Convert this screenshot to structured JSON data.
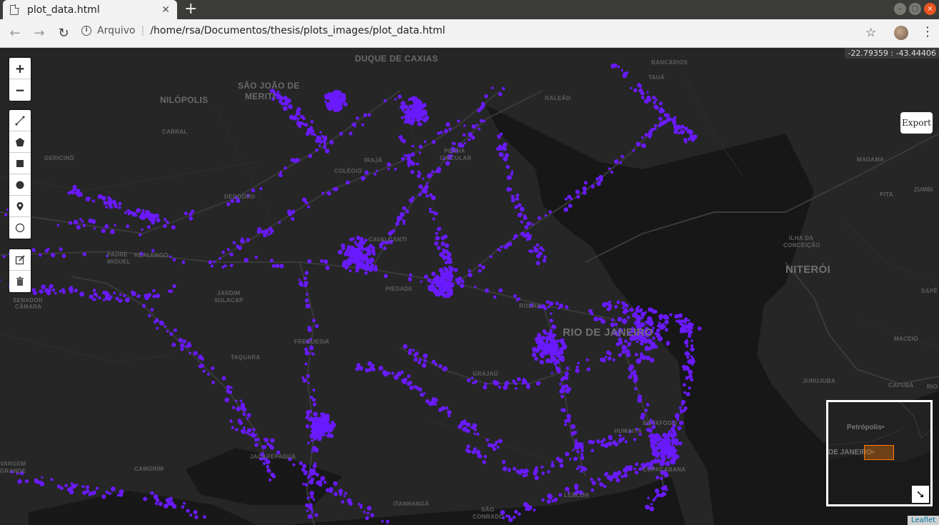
{
  "browser": {
    "tab_title": "plot_data.html",
    "tab_close": "✕",
    "new_tab": "+",
    "scheme": "Arquivo",
    "separator": "|",
    "url": "/home/rsa/Documentos/thesis/plots_images/plot_data.html",
    "icons": [
      "back-icon",
      "forward-icon",
      "reload-icon",
      "info-icon",
      "star-icon",
      "profile-icon",
      "menu-icon"
    ]
  },
  "map": {
    "coordinates": "-22.79359 : -43.44406",
    "export_label": "Export",
    "attribution": "Leaflet",
    "point_color": "#6a1aff",
    "zoom_in": "+",
    "zoom_out": "−",
    "draw_tools": [
      "polyline-icon",
      "polygon-icon",
      "rectangle-icon",
      "circle-icon",
      "marker-icon",
      "circlemarker-icon"
    ],
    "edit_tools": [
      "edit-icon",
      "delete-icon"
    ],
    "places": {
      "duque_de_caxias": "DUQUE DE CAXIAS",
      "sao_joao_1": "SÃO JOÃO DE",
      "sao_joao_2": "MERITI",
      "nilopolis": "NILÓPOLIS",
      "niteroi": "NITERÓI",
      "rio": "RIO DE JANEIRO",
      "cabral": "CABRAL",
      "gericino": "GERICINÓ",
      "bangu": "BANGU",
      "padre_miguel_1": "PADRE",
      "padre_miguel_2": "MIGUEL",
      "realengo": "REALENGO",
      "senador_camara_1": "SENADOR",
      "senador_camara_2": "CÂMARA",
      "jardim_sulacap_1": "JARDIM",
      "jardim_sulacap_2": "SULACAP",
      "taquara": "TAQUARA",
      "jacarepagua": "JACAREPAGUÁ",
      "vargem_grande_1": "VARGEM",
      "vargem_grande_2": "GRANDE",
      "camorim": "CAMORIM",
      "itanhanga": "ITANHANGÁ",
      "sao_conrado_1": "SÃO",
      "sao_conrado_2": "CONRADO",
      "leblon": "LEBLON",
      "copacabana": "COPACABANA",
      "humaita": "HUMAITÁ",
      "botafogo": "BOTAFOGO",
      "grajau": "GRAJAÚ",
      "rocha": "ROCHA",
      "piedade": "PIEDADE",
      "cavalcanti": "CAVALCANTI",
      "colegio": "COLÉGIO",
      "iraja": "IRAJÁ",
      "penha_1": "PENHA",
      "penha_2": "CIRCULAR",
      "galeao": "GALEÃO",
      "bancarios": "BANCÁRIOS",
      "taua": "TAUÁ",
      "deodoro": "DEODORO",
      "anchieta": "ANCHIETA",
      "freguesia": "FREGUESIA",
      "madama": "MADAMA",
      "zumbi": "ZUMBI",
      "pita": "PITA",
      "ilha_1": "ILHA DA",
      "ilha_2": "CONCEIÇÃO",
      "sape": "SAPÊ",
      "maceio": "MACEIÓ",
      "jurujuba": "JURUJUBA",
      "cafuba": "CAFUBÁ",
      "rio_right": "RIO"
    },
    "minimap": {
      "petropolis": "Petrópolis•",
      "rio": "DE JANEIRO•",
      "toggle": "➘"
    }
  }
}
